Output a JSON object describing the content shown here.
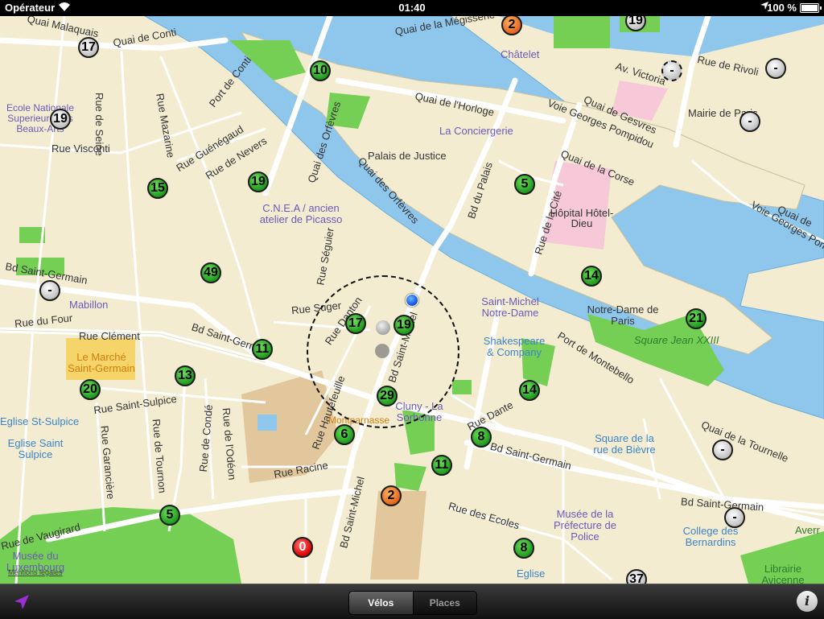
{
  "status_bar": {
    "carrier": "Opérateur",
    "time": "01:40",
    "battery": "100 %"
  },
  "map": {
    "labels": {
      "quai_malaquais": "Quai Malaquais",
      "quai_de_conti": "Quai de Conti",
      "rue_de_seine": "Rue de Seine",
      "rue_mazarine": "Rue Mazarine",
      "port_de_conti": "Port de Conti",
      "ecole_beaux_arts": "Ecole Nationale Superieure des Beaux-Arts",
      "rue_visconti": "Rue Visconti",
      "rue_guenegaud": "Rue Guénégaud",
      "rue_de_nevers": "Rue de Nevers",
      "quai_des_orfevres_1": "Quai des Orfèvres",
      "quai_des_orfevres_2": "Quai des Orfèvres",
      "quai_de_lhorloge": "Quai de l'Horloge",
      "palais_de_justice": "Palais de Justice",
      "la_conciergerie": "La Conciergerie",
      "chatelet": "Châtelet",
      "quai_megisserie": "Quai de la Mégisserie",
      "rue_de_rivoli": "Rue de Rivoli",
      "av_victoria": "Av. Victoria",
      "mairie_de_paris": "Mairie de Paris",
      "quai_de_gesvres": "Quai de Gesvres",
      "voie_georges_pompidou": "Voie Georges Pompidou",
      "voie_georges_pompidou_2": "Voie Georges Pompidou",
      "quai_de_la_corse": "Quai de la Corse",
      "quai_de": "Quai de",
      "bd_du_palais": "Bd du Palais",
      "rue_de_la_cite": "Rue de la Cité",
      "hopital_hotel_dieu": "Hôpital Hôtel-Dieu",
      "cnea": "C.N.E.A / ancien atelier de Picasso",
      "rue_seguier": "Rue Séguier",
      "saint_michel_notre_dame": "Saint-Michel Notre-Dame",
      "notre_dame_de_paris": "Notre-Dame de Paris",
      "square_jean_xxiii": "Square Jean XXIII",
      "bd_saint_germain_w": "Bd Saint-Germain",
      "mabillon": "Mabillon",
      "rue_du_four": "Rue du Four",
      "rue_suger": "Rue Suger",
      "rue_danton": "Rue Danton",
      "bd_saint_michel": "Bd Saint-Michel",
      "rue_clement": "Rue Clément",
      "bd_saint_germain_mid": "Bd Saint-Germain",
      "marche_saint_germain": "Le Marché Saint-Germain",
      "shakespeare": "Shakespeare & Company",
      "port_de_montebello": "Port de Montebello",
      "rue_hautefeuille": "Rue Hautefeuille",
      "rue_saint_sulpice": "Rue Saint-Sulpice",
      "eglise_st_sulpice": "Eglise St-Sulpice",
      "eglise_saint_sulpice": "Eglise Saint Sulpice",
      "rue_de_conde": "Rue de Condé",
      "rue_de_lodeon": "Rue de l'Odéon",
      "rue_garanciere": "Rue Garancière",
      "rue_de_tournon": "Rue de Tournon",
      "cluny": "Cluny - La Sorbonne",
      "rue_dante": "Rue Dante",
      "bd_saint_germain_e": "Bd Saint-Germain",
      "square_rue_bievre": "Square de la rue de Bièvre",
      "quai_tournelle": "Quai de la Tournelle",
      "rue_racine": "Rue Racine",
      "odeon": "Montparnasse",
      "bd_saint_michel_2": "Bd Saint-Michel",
      "rue_des_ecoles": "Rue des Ecoles",
      "musee_prefecture": "Musée de la Préfecture de Police",
      "bd_saint_germain_far": "Bd Saint-Germain",
      "college_bernardins": "College des Bernardins",
      "rue_de_vaugirard": "Rue de Vaugirard",
      "musee_luxembourg": "Musée du Luxembourg",
      "eglise_bottom": "Eglise",
      "librairie": "Librairie Avicenne",
      "avenue": "Averr",
      "bd_saint_michel_3": "Bd Saint-Michel",
      "rue_nev": "Rue",
      "legal": "Mentions légales"
    },
    "stations": [
      {
        "value": "17",
        "color": "grey"
      },
      {
        "value": "19",
        "color": "grey"
      },
      {
        "value": "10",
        "color": "green"
      },
      {
        "value": "2",
        "color": "orange"
      },
      {
        "value": "19",
        "color": "grey"
      },
      {
        "value": "-",
        "color": "grey-dashed"
      },
      {
        "value": "-",
        "color": "grey"
      },
      {
        "value": "-",
        "color": "grey"
      },
      {
        "value": "15",
        "color": "green"
      },
      {
        "value": "19",
        "color": "green"
      },
      {
        "value": "5",
        "color": "green"
      },
      {
        "value": "49",
        "color": "green"
      },
      {
        "value": "-",
        "color": "grey"
      },
      {
        "value": "14",
        "color": "green"
      },
      {
        "value": "21",
        "color": "green"
      },
      {
        "value": "17",
        "color": "green"
      },
      {
        "value": "19",
        "color": "green"
      },
      {
        "value": "11",
        "color": "green"
      },
      {
        "value": "13",
        "color": "green"
      },
      {
        "value": "20",
        "color": "green"
      },
      {
        "value": "29",
        "color": "green"
      },
      {
        "value": "14",
        "color": "green"
      },
      {
        "value": "6",
        "color": "green"
      },
      {
        "value": "8",
        "color": "green"
      },
      {
        "value": "11",
        "color": "green"
      },
      {
        "value": "-",
        "color": "grey"
      },
      {
        "value": "2",
        "color": "orange"
      },
      {
        "value": "5",
        "color": "green"
      },
      {
        "value": "-",
        "color": "grey"
      },
      {
        "value": "0",
        "color": "red"
      },
      {
        "value": "8",
        "color": "green"
      },
      {
        "value": "37",
        "color": "grey"
      }
    ]
  },
  "toolbar": {
    "velos_label": "Vélos",
    "places_label": "Places",
    "info_label": "i"
  },
  "colors": {
    "water": "#8fc6ec",
    "land": "#f3ecd0",
    "park": "#74cf54",
    "hospital": "#f6c8d8"
  }
}
